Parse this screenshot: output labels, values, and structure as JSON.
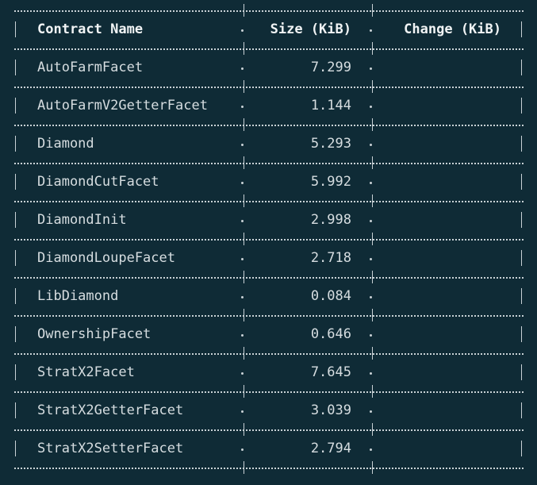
{
  "table": {
    "headers": {
      "name": "Contract Name",
      "size": "Size (KiB)",
      "change": "Change (KiB)"
    },
    "rows": [
      {
        "name": "AutoFarmFacet",
        "size": "7.299",
        "change": ""
      },
      {
        "name": "AutoFarmV2GetterFacet",
        "size": "1.144",
        "change": ""
      },
      {
        "name": "Diamond",
        "size": "5.293",
        "change": ""
      },
      {
        "name": "DiamondCutFacet",
        "size": "5.992",
        "change": ""
      },
      {
        "name": "DiamondInit",
        "size": "2.998",
        "change": ""
      },
      {
        "name": "DiamondLoupeFacet",
        "size": "2.718",
        "change": ""
      },
      {
        "name": "LibDiamond",
        "size": "0.084",
        "change": ""
      },
      {
        "name": "OwnershipFacet",
        "size": "0.646",
        "change": ""
      },
      {
        "name": "StratX2Facet",
        "size": "7.645",
        "change": ""
      },
      {
        "name": "StratX2GetterFacet",
        "size": "3.039",
        "change": ""
      },
      {
        "name": "StratX2SetterFacet",
        "size": "2.794",
        "change": ""
      }
    ]
  },
  "colors": {
    "background": "#0f2b36",
    "text": "#d6dde0",
    "border": "#c9d2d6"
  }
}
